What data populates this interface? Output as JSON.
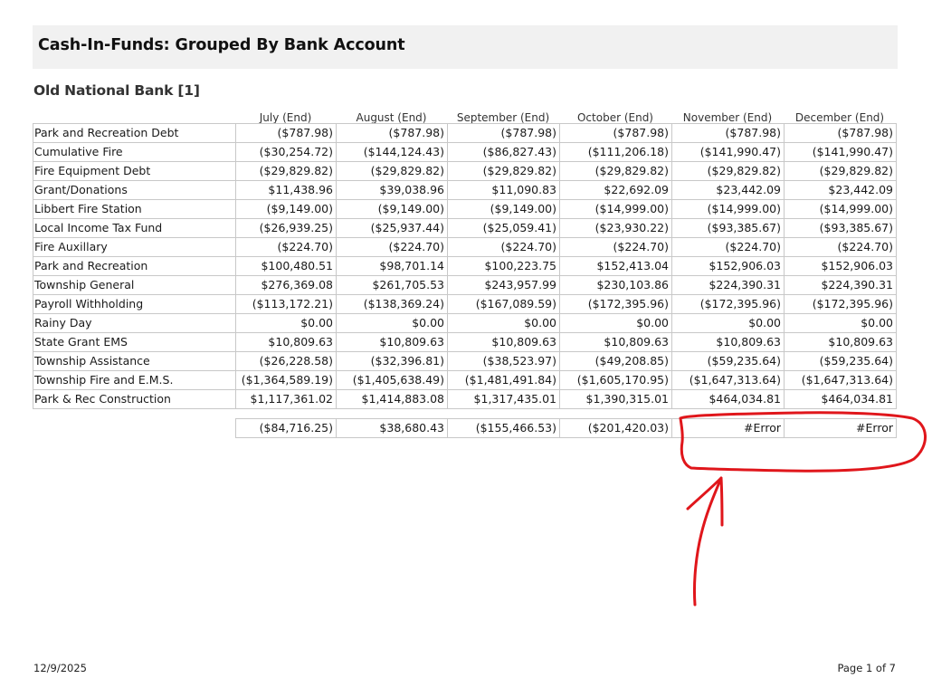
{
  "report": {
    "title": "Cash-In-Funds: Grouped By Bank Account",
    "bank": "Old National Bank [1]"
  },
  "columns": [
    "July (End)",
    "August (End)",
    "September (End)",
    "October (End)",
    "November (End)",
    "December (End)"
  ],
  "rows": [
    {
      "name": "Park and Recreation Debt",
      "values": [
        "($787.98)",
        "($787.98)",
        "($787.98)",
        "($787.98)",
        "($787.98)",
        "($787.98)"
      ]
    },
    {
      "name": "Cumulative Fire",
      "values": [
        "($30,254.72)",
        "($144,124.43)",
        "($86,827.43)",
        "($111,206.18)",
        "($141,990.47)",
        "($141,990.47)"
      ]
    },
    {
      "name": "Fire Equipment Debt",
      "values": [
        "($29,829.82)",
        "($29,829.82)",
        "($29,829.82)",
        "($29,829.82)",
        "($29,829.82)",
        "($29,829.82)"
      ]
    },
    {
      "name": "Grant/Donations",
      "values": [
        "$11,438.96",
        "$39,038.96",
        "$11,090.83",
        "$22,692.09",
        "$23,442.09",
        "$23,442.09"
      ]
    },
    {
      "name": "Libbert Fire Station",
      "values": [
        "($9,149.00)",
        "($9,149.00)",
        "($9,149.00)",
        "($14,999.00)",
        "($14,999.00)",
        "($14,999.00)"
      ]
    },
    {
      "name": "Local Income Tax Fund",
      "values": [
        "($26,939.25)",
        "($25,937.44)",
        "($25,059.41)",
        "($23,930.22)",
        "($93,385.67)",
        "($93,385.67)"
      ]
    },
    {
      "name": "Fire Auxillary",
      "values": [
        "($224.70)",
        "($224.70)",
        "($224.70)",
        "($224.70)",
        "($224.70)",
        "($224.70)"
      ]
    },
    {
      "name": "Park and Recreation",
      "values": [
        "$100,480.51",
        "$98,701.14",
        "$100,223.75",
        "$152,413.04",
        "$152,906.03",
        "$152,906.03"
      ]
    },
    {
      "name": "Township General",
      "values": [
        "$276,369.08",
        "$261,705.53",
        "$243,957.99",
        "$230,103.86",
        "$224,390.31",
        "$224,390.31"
      ]
    },
    {
      "name": "Payroll Withholding",
      "values": [
        "($113,172.21)",
        "($138,369.24)",
        "($167,089.59)",
        "($172,395.96)",
        "($172,395.96)",
        "($172,395.96)"
      ]
    },
    {
      "name": "Rainy Day",
      "values": [
        "$0.00",
        "$0.00",
        "$0.00",
        "$0.00",
        "$0.00",
        "$0.00"
      ]
    },
    {
      "name": "State Grant EMS",
      "values": [
        "$10,809.63",
        "$10,809.63",
        "$10,809.63",
        "$10,809.63",
        "$10,809.63",
        "$10,809.63"
      ]
    },
    {
      "name": "Township Assistance",
      "values": [
        "($26,228.58)",
        "($32,396.81)",
        "($38,523.97)",
        "($49,208.85)",
        "($59,235.64)",
        "($59,235.64)"
      ]
    },
    {
      "name": "Township Fire and E.M.S.",
      "values": [
        "($1,364,589.19)",
        "($1,405,638.49)",
        "($1,481,491.84)",
        "($1,605,170.95)",
        "($1,647,313.64)",
        "($1,647,313.64)"
      ]
    },
    {
      "name": "Park & Rec Construction",
      "values": [
        "$1,117,361.02",
        "$1,414,883.08",
        "$1,317,435.01",
        "$1,390,315.01",
        "$464,034.81",
        "$464,034.81"
      ]
    }
  ],
  "totals": [
    "($84,716.25)",
    "$38,680.43",
    "($155,466.53)",
    "($201,420.03)",
    "#Error",
    "#Error"
  ],
  "annotation": {
    "color": "#e0161b"
  },
  "footer": {
    "date": "12/9/2025",
    "page": "Page 1 of 7"
  }
}
